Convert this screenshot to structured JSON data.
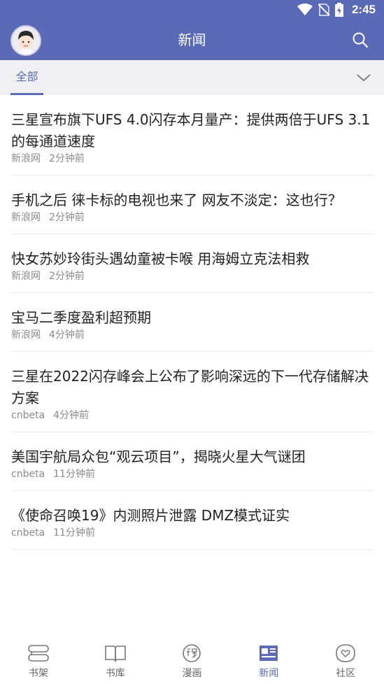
{
  "status_bar": {
    "time": "2:45"
  },
  "app_bar": {
    "title": "新闻"
  },
  "tabs": {
    "active_label": "全部"
  },
  "news": [
    {
      "title": "三星宣布旗下UFS 4.0闪存本月量产：提供两倍于UFS 3.1的每通道速度",
      "source": "新浪网",
      "time": "2分钟前"
    },
    {
      "title": "手机之后 徕卡标的电视也来了 网友不淡定：这也行？",
      "source": "新浪网",
      "time": "2分钟前"
    },
    {
      "title": "快女苏妙玲街头遇幼童被卡喉 用海姆立克法相救",
      "source": "新浪网",
      "time": "2分钟前"
    },
    {
      "title": "宝马二季度盈利超预期",
      "source": "新浪网",
      "time": "4分钟前"
    },
    {
      "title": "三星在2022闪存峰会上公布了影响深远的下一代存储解决方案",
      "source": "cnbeta",
      "time": "4分钟前"
    },
    {
      "title": "美国宇航局众包“观云项目”，揭晓火星大气谜团",
      "source": "cnbeta",
      "time": "11分钟前"
    },
    {
      "title": "《使命召唤19》内测照片泄露 DMZ模式证实",
      "source": "cnbeta",
      "time": "11分钟前"
    }
  ],
  "bottom_nav": {
    "bookshelf": "书架",
    "library": "书库",
    "comics": "漫画",
    "news": "新闻",
    "community": "社区"
  },
  "colors": {
    "primary": "#5b6ab7",
    "tab_bg": "#f0f0f3"
  }
}
